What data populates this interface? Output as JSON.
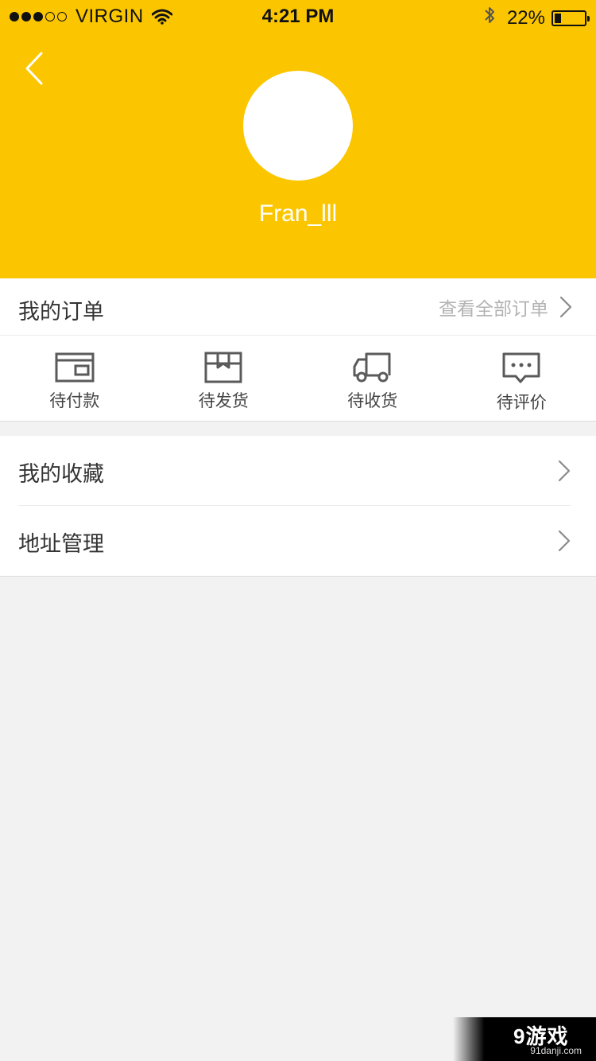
{
  "status_bar": {
    "carrier": "VIRGIN",
    "time": "4:21 PM",
    "battery_text": "22%",
    "battery_level": 0.22,
    "signal_bars_full": 3,
    "signal_bars_total": 5,
    "icons": [
      "wifi-icon",
      "bluetooth-icon",
      "battery-icon"
    ]
  },
  "header": {
    "username": "Fran_lll",
    "background_color": "#fbc600",
    "back_icon": "chevron-left-icon"
  },
  "orders": {
    "title": "我的订单",
    "view_all": "查看全部订单",
    "tabs": [
      {
        "label": "待付款",
        "icon": "wallet-icon"
      },
      {
        "label": "待发货",
        "icon": "package-box-icon"
      },
      {
        "label": "待收货",
        "icon": "delivery-truck-icon"
      },
      {
        "label": "待评价",
        "icon": "comment-bubble-icon"
      }
    ]
  },
  "menu": {
    "items": [
      {
        "label": "我的收藏",
        "icon": "chevron-right-icon"
      },
      {
        "label": "地址管理",
        "icon": "chevron-right-icon"
      }
    ]
  },
  "watermark": {
    "logo": "9游戏",
    "url": "91danji.com"
  }
}
